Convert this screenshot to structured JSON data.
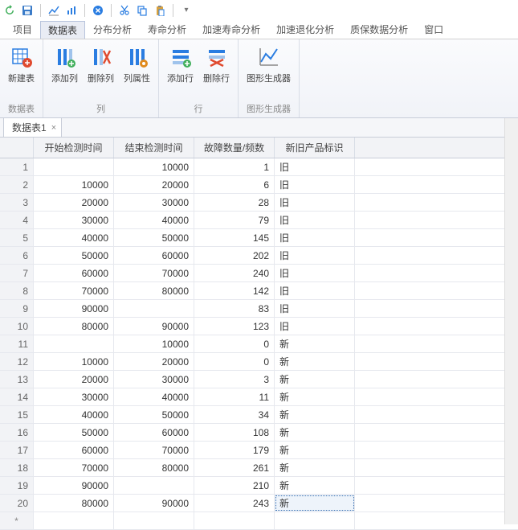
{
  "titlebar_icons": [
    "refresh",
    "save",
    "chart-line",
    "chart-bar",
    "close-circle",
    "cut",
    "copy",
    "paste",
    "dropdown"
  ],
  "menu": {
    "items": [
      "项目",
      "数据表",
      "分布分析",
      "寿命分析",
      "加速寿命分析",
      "加速退化分析",
      "质保数据分析",
      "窗口"
    ],
    "active_index": 1
  },
  "ribbon": {
    "groups": [
      {
        "title": "数据表",
        "buttons": [
          {
            "icon": "new-table",
            "label": "新建表",
            "color": "#2a7de1"
          }
        ]
      },
      {
        "title": "列",
        "buttons": [
          {
            "icon": "add-col",
            "label": "添加列",
            "color": "#2a7de1"
          },
          {
            "icon": "del-col",
            "label": "删除列",
            "color": "#e04a2f"
          },
          {
            "icon": "col-props",
            "label": "列属性",
            "color": "#e08a1e"
          }
        ]
      },
      {
        "title": "行",
        "buttons": [
          {
            "icon": "add-row",
            "label": "添加行",
            "color": "#2a7de1"
          },
          {
            "icon": "del-row",
            "label": "删除行",
            "color": "#e04a2f"
          }
        ]
      },
      {
        "title": "图形生成器",
        "buttons": [
          {
            "icon": "chart-gen",
            "label": "图形生成器",
            "color": "#2a7de1"
          }
        ]
      }
    ]
  },
  "workspace_tab": {
    "label": "数据表1",
    "close": "×"
  },
  "columns": [
    "",
    "开始检测时间",
    "结束检测时间",
    "故障数量/频数",
    "新旧产品标识"
  ],
  "rows": [
    {
      "n": "1",
      "start": "",
      "end": "10000",
      "fail": "1",
      "flag": "旧"
    },
    {
      "n": "2",
      "start": "10000",
      "end": "20000",
      "fail": "6",
      "flag": "旧"
    },
    {
      "n": "3",
      "start": "20000",
      "end": "30000",
      "fail": "28",
      "flag": "旧"
    },
    {
      "n": "4",
      "start": "30000",
      "end": "40000",
      "fail": "79",
      "flag": "旧"
    },
    {
      "n": "5",
      "start": "40000",
      "end": "50000",
      "fail": "145",
      "flag": "旧"
    },
    {
      "n": "6",
      "start": "50000",
      "end": "60000",
      "fail": "202",
      "flag": "旧"
    },
    {
      "n": "7",
      "start": "60000",
      "end": "70000",
      "fail": "240",
      "flag": "旧"
    },
    {
      "n": "8",
      "start": "70000",
      "end": "80000",
      "fail": "142",
      "flag": "旧"
    },
    {
      "n": "9",
      "start": "90000",
      "end": "",
      "fail": "83",
      "flag": "旧"
    },
    {
      "n": "10",
      "start": "80000",
      "end": "90000",
      "fail": "123",
      "flag": "旧"
    },
    {
      "n": "11",
      "start": "",
      "end": "10000",
      "fail": "0",
      "flag": "新"
    },
    {
      "n": "12",
      "start": "10000",
      "end": "20000",
      "fail": "0",
      "flag": "新"
    },
    {
      "n": "13",
      "start": "20000",
      "end": "30000",
      "fail": "3",
      "flag": "新"
    },
    {
      "n": "14",
      "start": "30000",
      "end": "40000",
      "fail": "11",
      "flag": "新"
    },
    {
      "n": "15",
      "start": "40000",
      "end": "50000",
      "fail": "34",
      "flag": "新"
    },
    {
      "n": "16",
      "start": "50000",
      "end": "60000",
      "fail": "108",
      "flag": "新"
    },
    {
      "n": "17",
      "start": "60000",
      "end": "70000",
      "fail": "179",
      "flag": "新"
    },
    {
      "n": "18",
      "start": "70000",
      "end": "80000",
      "fail": "261",
      "flag": "新"
    },
    {
      "n": "19",
      "start": "90000",
      "end": "",
      "fail": "210",
      "flag": "新"
    },
    {
      "n": "20",
      "start": "80000",
      "end": "90000",
      "fail": "243",
      "flag": "新"
    }
  ],
  "star_row": "*",
  "selected_cell": {
    "row": 19,
    "col": "flag"
  }
}
